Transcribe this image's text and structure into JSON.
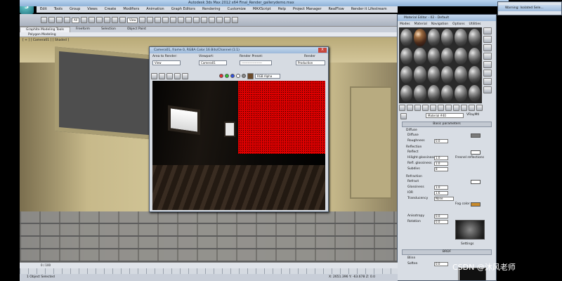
{
  "app": {
    "title": "Autodesk 3ds Max 2012 x64    Final_Render_gallerydemo.max",
    "logo": "3"
  },
  "menubar": [
    "Edit",
    "Tools",
    "Group",
    "Views",
    "Create",
    "Modifiers",
    "Animation",
    "Graph Editors",
    "Rendering",
    "Customize",
    "MAXScript",
    "Help",
    "Project Manager",
    "RealFlow",
    "Render it Lifestream"
  ],
  "toolbar": {
    "selection_filter": "All",
    "view_select": "View"
  },
  "ribbon": {
    "tabs": [
      "Graphite Modeling Tools",
      "Freeform",
      "Selection",
      "Object Paint"
    ],
    "subtab": "Polygon Modeling"
  },
  "viewport": {
    "label": "[ + ] [ Camera01 ] [ Shaded ]"
  },
  "render_window": {
    "title": "Camera01, frame 0, RGBA Color 16 Bits/Channel (1:1)",
    "area_label": "Area to Render:",
    "area_value": "View",
    "viewport_label": "Viewport:",
    "viewport_value": "Camera01",
    "preset_label": "Render Preset:",
    "preset_value": "--------------------",
    "render_label": "Render",
    "render_value": "Production",
    "channel_value": "RGB Alpha",
    "close": "X"
  },
  "material_editor": {
    "title": "Material Editor - 02 - Default",
    "menu": [
      "Modes",
      "Material",
      "Navigation",
      "Options",
      "Utilities"
    ],
    "material_name": "Material #40",
    "material_type": "VRayMtl",
    "rollout_basic": "Basic parameters",
    "diffuse_section": "Diffuse",
    "diffuse_label": "Diffuse",
    "roughness_label": "Roughness",
    "roughness_value": "0.0",
    "reflection_section": "Reflection",
    "reflect_label": "Reflect",
    "hilight_gloss_label": "Hilight glossiness",
    "hilight_gloss_value": "1.0",
    "refl_gloss_label": "Refl. glossiness",
    "refl_gloss_value": "1.0",
    "subdivs_label": "Subdivs",
    "subdivs_value": "8",
    "fresnel_label": "Fresnel reflections",
    "refraction_section": "Refraction",
    "refract_label": "Refract",
    "ior_label": "IOR",
    "ior_value": "1.6",
    "glossiness_label": "Glossiness",
    "glossiness_value": "1.0",
    "fog_color_label": "Fog color",
    "translucency_label": "Translucency",
    "translucency_value": "None",
    "anisotropy_label": "Anisotropy",
    "anisotropy_value": "0.0",
    "rotation_label": "Rotation",
    "rotation_value": "0.0",
    "brdf_section": "BRDF",
    "brdf_type": "Blinn",
    "soften_label": "Soften",
    "soften_value": "0.0",
    "settings_label": "Settings"
  },
  "extra_window": {
    "title": "Warning: Isolated Sele..."
  },
  "statusbar": {
    "frame": "0 / 100",
    "status_text": "1 Object Selected",
    "coords": "X: 2651.396   Y: -63.678   Z: 0.0"
  },
  "watermark": "CSDN @沐风老师",
  "colors": {
    "titlebar": "#9cb9da",
    "accent_red": "#dd0000"
  }
}
